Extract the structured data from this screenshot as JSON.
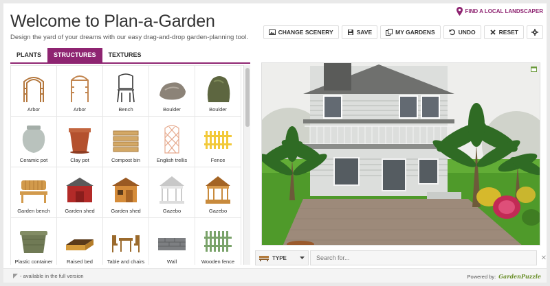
{
  "header": {
    "title": "Welcome to Plan-a-Garden",
    "subtitle": "Design the yard of your dreams with our easy drag-and-drop garden-planning tool.",
    "landscaper_link": "FIND A LOCAL LANDSCAPER"
  },
  "toolbar": {
    "change_scenery": "CHANGE SCENERY",
    "save": "SAVE",
    "my_gardens": "MY GARDENS",
    "undo": "UNDO",
    "reset": "RESET"
  },
  "tabs": [
    {
      "label": "PLANTS",
      "active": false
    },
    {
      "label": "STRUCTURES",
      "active": true
    },
    {
      "label": "TEXTURES",
      "active": false
    }
  ],
  "catalog": {
    "items": [
      {
        "label": "Arbor",
        "icon": "arbor"
      },
      {
        "label": "Arbor",
        "icon": "arbor2"
      },
      {
        "label": "Bench",
        "icon": "bench"
      },
      {
        "label": "Boulder",
        "icon": "boulder"
      },
      {
        "label": "Boulder",
        "icon": "boulder2"
      },
      {
        "label": "Ceramic pot",
        "icon": "ceramic-pot"
      },
      {
        "label": "Clay pot",
        "icon": "clay-pot"
      },
      {
        "label": "Compost bin",
        "icon": "compost-bin"
      },
      {
        "label": "English trellis",
        "icon": "trellis"
      },
      {
        "label": "Fence",
        "icon": "fence"
      },
      {
        "label": "Garden bench",
        "icon": "garden-bench"
      },
      {
        "label": "Garden shed",
        "icon": "shed-red"
      },
      {
        "label": "Garden shed",
        "icon": "shed-wood"
      },
      {
        "label": "Gazebo",
        "icon": "gazebo-white"
      },
      {
        "label": "Gazebo",
        "icon": "gazebo-wood"
      },
      {
        "label": "Plastic container",
        "icon": "container"
      },
      {
        "label": "Raised bed",
        "icon": "raised-bed"
      },
      {
        "label": "Table and chairs",
        "icon": "table-chairs"
      },
      {
        "label": "Wall",
        "icon": "wall"
      },
      {
        "label": "Wooden fence",
        "icon": "wooden-fence"
      }
    ]
  },
  "bottom": {
    "type_label": "TYPE",
    "search_placeholder": "Search for..."
  },
  "footer": {
    "note": "- available in the full version",
    "powered_by": "Powered by:",
    "brand": "GardenPuzzle"
  },
  "colors": {
    "accent": "#8e2471",
    "grass": "#4f9a2a",
    "paver": "#9d8a7a"
  }
}
